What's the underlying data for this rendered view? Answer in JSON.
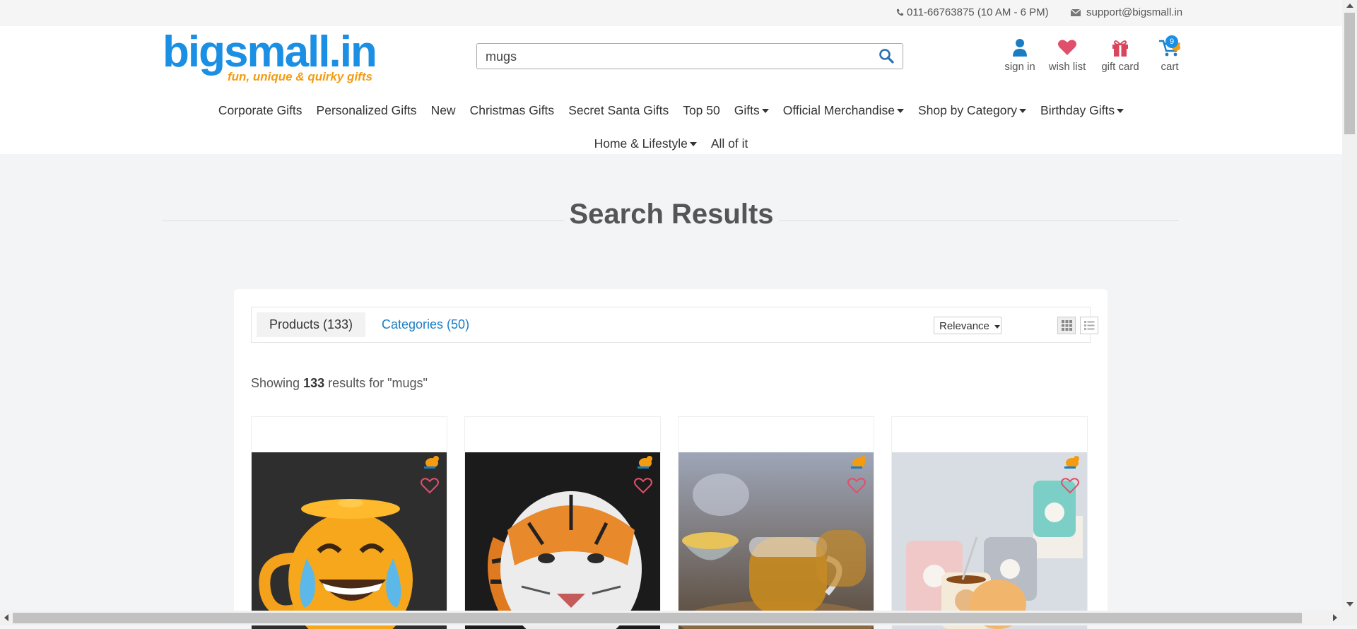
{
  "topbar": {
    "phone": "011-66763875 (10 AM - 6 PM)",
    "email": "support@bigsmall.in"
  },
  "logo": {
    "main": "bigsmall.in",
    "tagline": "fun, unique & quirky gifts"
  },
  "search": {
    "value": "mugs",
    "placeholder": ""
  },
  "header_icons": {
    "signin": "sign in",
    "wishlist": "wish list",
    "giftcard": "gift card",
    "cart": "cart",
    "cart_count": "9"
  },
  "nav": {
    "row1": [
      {
        "label": "Corporate Gifts",
        "dropdown": false
      },
      {
        "label": "Personalized Gifts",
        "dropdown": false
      },
      {
        "label": "New",
        "dropdown": false
      },
      {
        "label": "Christmas Gifts",
        "dropdown": false
      },
      {
        "label": "Secret Santa Gifts",
        "dropdown": false
      },
      {
        "label": "Top 50",
        "dropdown": false
      },
      {
        "label": "Gifts",
        "dropdown": true
      },
      {
        "label": "Official Merchandise",
        "dropdown": true
      },
      {
        "label": "Shop by Category",
        "dropdown": true
      },
      {
        "label": "Birthday Gifts",
        "dropdown": true
      }
    ],
    "row2": [
      {
        "label": "Home & Lifestyle",
        "dropdown": true
      },
      {
        "label": "All of it",
        "dropdown": false
      }
    ]
  },
  "page": {
    "title": "Search Results"
  },
  "results": {
    "tab_products": "Products (133)",
    "tab_categories": "Categories (50)",
    "sort": "Relevance",
    "showing_prefix": "Showing",
    "showing_count": "133",
    "showing_suffix": "results for \"mugs\""
  },
  "products": [
    {
      "image": "emoji-mug"
    },
    {
      "image": "tiger-mug"
    },
    {
      "image": "glass-mugs"
    },
    {
      "image": "bear-mugs"
    }
  ],
  "colors": {
    "brand_blue": "#1a8fe3",
    "brand_orange": "#f39c12",
    "heart": "#e0506a",
    "link": "#1a7dc4"
  }
}
